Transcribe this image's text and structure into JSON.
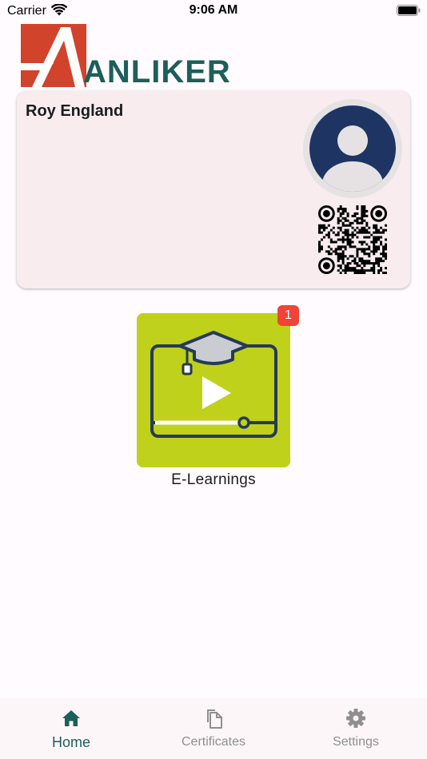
{
  "status_bar": {
    "carrier": "Carrier",
    "time": "9:06 AM"
  },
  "logo": {
    "text": "ANLIKER",
    "colors": {
      "red": "#d1432b",
      "teal": "#1d5f5a"
    }
  },
  "card": {
    "name": "Roy England",
    "avatar_icon": "person-icon",
    "qr_icon": "qr-code-icon"
  },
  "tiles": [
    {
      "label": "E-Learnings",
      "badge": "1",
      "icon": "graduation-video-icon",
      "color": "#bfd11b"
    }
  ],
  "bottom_nav": {
    "items": [
      {
        "label": "Home",
        "icon": "home-icon",
        "active": true
      },
      {
        "label": "Certificates",
        "icon": "copy-icon",
        "active": false
      },
      {
        "label": "Settings",
        "icon": "gear-icon",
        "active": false
      }
    ],
    "active_color": "#1d5f5a",
    "inactive_color": "#8f8f8f"
  }
}
